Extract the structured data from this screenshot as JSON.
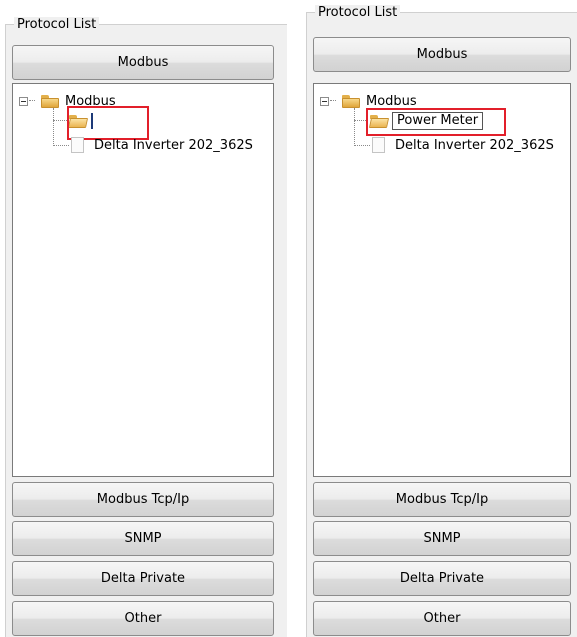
{
  "left_panel": {
    "title": "Protocol List",
    "top_button": "Modbus",
    "tree": {
      "root_label": "Modbus",
      "editing_value": "",
      "child_label": "Delta Inverter 202_362S"
    },
    "buttons": [
      "Modbus Tcp/Ip",
      "SNMP",
      "Delta Private",
      "Other"
    ]
  },
  "right_panel": {
    "title": "Protocol List",
    "top_button": "Modbus",
    "tree": {
      "root_label": "Modbus",
      "editing_value": "Power Meter",
      "child_label": "Delta Inverter 202_362S"
    },
    "buttons": [
      "Modbus Tcp/Ip",
      "SNMP",
      "Delta Private",
      "Other"
    ]
  },
  "colors": {
    "highlight": "#e21f2a",
    "panel_bg": "#f0f0f0"
  }
}
